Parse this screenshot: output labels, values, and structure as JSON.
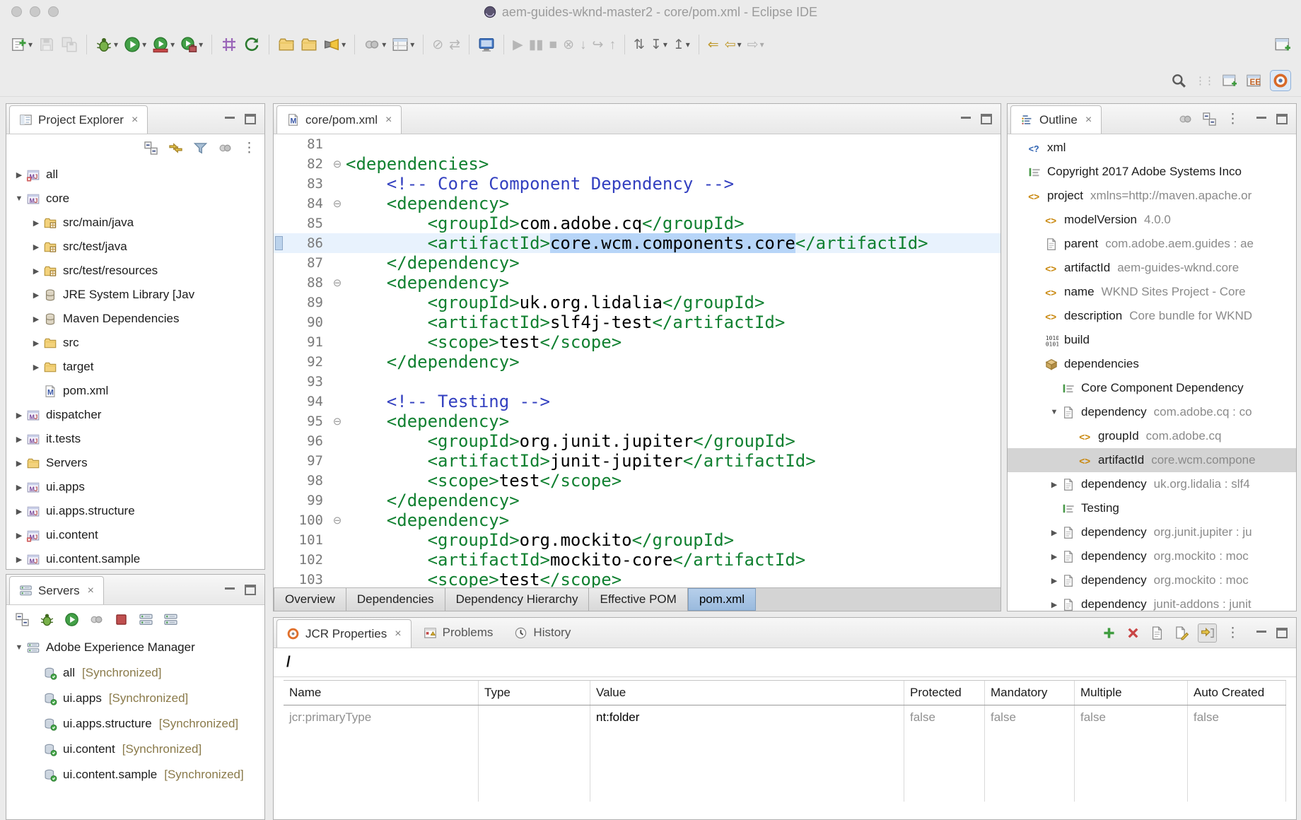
{
  "titlebar": {
    "title": "aem-guides-wknd-master2 - core/pom.xml - Eclipse IDE"
  },
  "colors": {
    "xml_tag": "#108030",
    "xml_comment": "#3340c0",
    "selection": "#b7d5f8",
    "current_line": "#e8f2fd",
    "sync_status": "#8a7a4a",
    "active_tab_blue": "#9abadd"
  },
  "main_toolbar": {
    "items": [
      {
        "name": "new-wizard",
        "icon": "new",
        "dropdown": true
      },
      {
        "name": "save",
        "icon": "floppy",
        "disabled": true
      },
      {
        "name": "save-all",
        "icon": "floppy2",
        "disabled": true
      },
      {
        "sep": true
      },
      {
        "name": "debug",
        "icon": "bug",
        "dropdown": true
      },
      {
        "name": "run",
        "icon": "runc",
        "dropdown": true
      },
      {
        "name": "coverage",
        "icon": "covc",
        "dropdown": true
      },
      {
        "name": "run-external-tools",
        "icon": "extc",
        "dropdown": true
      },
      {
        "sep": true
      },
      {
        "name": "new-java-project",
        "icon": "grid"
      },
      {
        "name": "generate",
        "icon": "gref"
      },
      {
        "sep": true
      },
      {
        "name": "open-type",
        "icon": "folder"
      },
      {
        "name": "open-resource",
        "icon": "folder"
      },
      {
        "name": "search",
        "icon": "torch",
        "dropdown": true
      },
      {
        "sep": true
      },
      {
        "name": "annotations",
        "icon": "graydot",
        "dropdown": true
      },
      {
        "name": "new-editor-window",
        "icon": "persp",
        "dropdown": true
      },
      {
        "sep": true
      },
      {
        "name": "skip-all-breakpoints",
        "glyph": "⊘",
        "disabled": true
      },
      {
        "name": "link-with-editor",
        "glyph": "⇄",
        "disabled": true
      },
      {
        "sep": true
      },
      {
        "name": "show-console",
        "icon": "monitor"
      },
      {
        "sep": true
      },
      {
        "name": "resume",
        "glyph": "▶",
        "disabled": true
      },
      {
        "name": "suspend",
        "glyph": "▮▮",
        "disabled": true
      },
      {
        "name": "terminate",
        "glyph": "■",
        "disabled": true
      },
      {
        "name": "disconnect",
        "glyph": "⊗",
        "disabled": true
      },
      {
        "name": "step-into",
        "glyph": "↓",
        "disabled": true
      },
      {
        "name": "step-over",
        "glyph": "↪",
        "disabled": true
      },
      {
        "name": "step-return",
        "glyph": "↑",
        "disabled": true
      },
      {
        "sep": true
      },
      {
        "name": "synchronize",
        "glyph": "⇅"
      },
      {
        "name": "fetch",
        "glyph": "↧",
        "dropdown": true
      },
      {
        "name": "push",
        "glyph": "↥",
        "dropdown": true
      },
      {
        "sep": true
      },
      {
        "name": "last-edit-location",
        "glyph": "⇐",
        "accent": true
      },
      {
        "name": "back",
        "glyph": "⇦",
        "dropdown": true,
        "accent": true
      },
      {
        "name": "forward",
        "glyph": "⇨",
        "dropdown": true,
        "disabled": true
      },
      {
        "name": "open-perspective-window",
        "icon": "winnew",
        "mlauto": true
      }
    ]
  },
  "perspective_bar": {
    "items": [
      {
        "name": "search",
        "icon": "mag"
      },
      {
        "handle": true
      },
      {
        "name": "open-perspective",
        "icon": "winnew"
      },
      {
        "name": "perspective-java-ee",
        "icon": "jee"
      },
      {
        "name": "perspective-current",
        "icon": "aemp",
        "active": true
      }
    ]
  },
  "project_explorer": {
    "title": "Project Explorer",
    "toolbar": [
      {
        "name": "collapse-all",
        "icon": "collapse"
      },
      {
        "name": "link-with-editor",
        "icon": "linkarrows"
      },
      {
        "name": "filters",
        "icon": "funnel"
      },
      {
        "name": "focus",
        "icon": "graydot"
      },
      {
        "name": "view-menu",
        "glyph": "⋮"
      }
    ],
    "items": [
      {
        "label": "all",
        "icon": "projecterr",
        "depth": 0,
        "exp": "c"
      },
      {
        "label": "core",
        "icon": "project",
        "depth": 0,
        "exp": "e"
      },
      {
        "label": "src/main/java",
        "icon": "srcfolder",
        "depth": 1,
        "exp": "c"
      },
      {
        "label": "src/test/java",
        "icon": "srcfolder",
        "depth": 1,
        "exp": "c"
      },
      {
        "label": "src/test/resources",
        "icon": "srcfolder",
        "depth": 1,
        "exp": "c"
      },
      {
        "label": "JRE System Library [Jav",
        "icon": "library",
        "depth": 1,
        "exp": "c"
      },
      {
        "label": "Maven Dependencies",
        "icon": "library",
        "depth": 1,
        "exp": "c"
      },
      {
        "label": "src",
        "icon": "folder",
        "depth": 1,
        "exp": "c"
      },
      {
        "label": "target",
        "icon": "folder",
        "depth": 1,
        "exp": "c"
      },
      {
        "label": "pom.xml",
        "icon": "mfile",
        "depth": 1
      },
      {
        "label": "dispatcher",
        "icon": "project",
        "depth": 0,
        "exp": "c"
      },
      {
        "label": "it.tests",
        "icon": "project",
        "depth": 0,
        "exp": "c"
      },
      {
        "label": "Servers",
        "icon": "folder",
        "depth": 0,
        "exp": "c"
      },
      {
        "label": "ui.apps",
        "icon": "project",
        "depth": 0,
        "exp": "c"
      },
      {
        "label": "ui.apps.structure",
        "icon": "project",
        "depth": 0,
        "exp": "c"
      },
      {
        "label": "ui.content",
        "icon": "projecterr",
        "depth": 0,
        "exp": "c"
      },
      {
        "label": "ui.content.sample",
        "icon": "project",
        "depth": 0,
        "exp": "c"
      }
    ]
  },
  "servers": {
    "title": "Servers",
    "toolbar": [
      {
        "name": "collapse-all",
        "icon": "collapse"
      },
      {
        "name": "debug-server",
        "icon": "bug"
      },
      {
        "name": "start-server",
        "icon": "runc"
      },
      {
        "name": "profile-server",
        "icon": "graydot"
      },
      {
        "name": "stop-server",
        "icon": "stopred"
      },
      {
        "name": "publish-to-server",
        "icon": "server"
      },
      {
        "name": "clean-server",
        "icon": "server"
      }
    ],
    "items": [
      {
        "label": "Adobe Experience Manager",
        "icon": "server",
        "depth": 0,
        "exp": "e"
      },
      {
        "label": "all",
        "status": "[Synchronized]",
        "icon": "bundle",
        "depth": 1
      },
      {
        "label": "ui.apps",
        "status": "[Synchronized]",
        "icon": "bundle",
        "depth": 1
      },
      {
        "label": "ui.apps.structure",
        "status": "[Synchronized]",
        "icon": "bundle",
        "depth": 1
      },
      {
        "label": "ui.content",
        "status": "[Synchronized]",
        "icon": "bundle",
        "depth": 1
      },
      {
        "label": "ui.content.sample",
        "status": "[Synchronized]",
        "icon": "bundle",
        "depth": 1
      }
    ]
  },
  "editor": {
    "tab_label": "core/pom.xml",
    "bottom_tabs": [
      {
        "label": "Overview"
      },
      {
        "label": "Dependencies"
      },
      {
        "label": "Dependency Hierarchy"
      },
      {
        "label": "Effective POM"
      },
      {
        "label": "pom.xml",
        "active": true
      }
    ],
    "lines": [
      {
        "n": 81,
        "tokens": []
      },
      {
        "n": 82,
        "fold": true,
        "tokens": [
          [
            "<dependencies>",
            "g"
          ]
        ]
      },
      {
        "n": 83,
        "tokens": [
          [
            "    <!-- Core Component Dependency -->",
            "c"
          ]
        ]
      },
      {
        "n": 84,
        "fold": true,
        "tokens": [
          [
            "    <dependency>",
            "g"
          ]
        ]
      },
      {
        "n": 85,
        "tokens": [
          [
            "        <groupId>",
            "g"
          ],
          [
            "com.adobe.cq",
            "t"
          ],
          [
            "</groupId>",
            "g"
          ]
        ]
      },
      {
        "n": 86,
        "cur": true,
        "marker": true,
        "tokens": [
          [
            "        <artifactId>",
            "g"
          ],
          [
            "core.wcm.components.core",
            "s"
          ],
          [
            "</artifactId>",
            "g"
          ]
        ]
      },
      {
        "n": 87,
        "tokens": [
          [
            "    </dependency>",
            "g"
          ]
        ]
      },
      {
        "n": 88,
        "fold": true,
        "tokens": [
          [
            "    <dependency>",
            "g"
          ]
        ]
      },
      {
        "n": 89,
        "tokens": [
          [
            "        <groupId>",
            "g"
          ],
          [
            "uk.org.lidalia",
            "t"
          ],
          [
            "</groupId>",
            "g"
          ]
        ]
      },
      {
        "n": 90,
        "tokens": [
          [
            "        <artifactId>",
            "g"
          ],
          [
            "slf4j-test",
            "t"
          ],
          [
            "</artifactId>",
            "g"
          ]
        ]
      },
      {
        "n": 91,
        "tokens": [
          [
            "        <scope>",
            "g"
          ],
          [
            "test",
            "t"
          ],
          [
            "</scope>",
            "g"
          ]
        ]
      },
      {
        "n": 92,
        "tokens": [
          [
            "    </dependency>",
            "g"
          ]
        ]
      },
      {
        "n": 93,
        "tokens": []
      },
      {
        "n": 94,
        "tokens": [
          [
            "    <!-- Testing -->",
            "c"
          ]
        ]
      },
      {
        "n": 95,
        "fold": true,
        "tokens": [
          [
            "    <dependency>",
            "g"
          ]
        ]
      },
      {
        "n": 96,
        "tokens": [
          [
            "        <groupId>",
            "g"
          ],
          [
            "org.junit.jupiter",
            "t"
          ],
          [
            "</groupId>",
            "g"
          ]
        ]
      },
      {
        "n": 97,
        "tokens": [
          [
            "        <artifactId>",
            "g"
          ],
          [
            "junit-jupiter",
            "t"
          ],
          [
            "</artifactId>",
            "g"
          ]
        ]
      },
      {
        "n": 98,
        "tokens": [
          [
            "        <scope>",
            "g"
          ],
          [
            "test",
            "t"
          ],
          [
            "</scope>",
            "g"
          ]
        ]
      },
      {
        "n": 99,
        "tokens": [
          [
            "    </dependency>",
            "g"
          ]
        ]
      },
      {
        "n": 100,
        "fold": true,
        "tokens": [
          [
            "    <dependency>",
            "g"
          ]
        ]
      },
      {
        "n": 101,
        "tokens": [
          [
            "        <groupId>",
            "g"
          ],
          [
            "org.mockito",
            "t"
          ],
          [
            "</groupId>",
            "g"
          ]
        ]
      },
      {
        "n": 102,
        "tokens": [
          [
            "        <artifactId>",
            "g"
          ],
          [
            "mockito-core",
            "t"
          ],
          [
            "</artifactId>",
            "g"
          ]
        ]
      },
      {
        "n": 103,
        "tokens": [
          [
            "        <scope>",
            "g"
          ],
          [
            "test",
            "t"
          ],
          [
            "</scope>",
            "g"
          ]
        ]
      }
    ]
  },
  "outline": {
    "title": "Outline",
    "toolbar": [
      {
        "name": "focus",
        "icon": "graydot"
      },
      {
        "name": "collapse-all",
        "icon": "collapse"
      },
      {
        "name": "view-menu",
        "glyph": "⋮"
      }
    ],
    "items": [
      {
        "label": "xml",
        "icon": "xmldecl",
        "depth": 0
      },
      {
        "label": "Copyright 2017 Adobe Systems Inco",
        "icon": "xmlcom",
        "depth": 0
      },
      {
        "label": "project",
        "detail": "xmlns=http://maven.apache.or",
        "icon": "xmlel",
        "depth": 0
      },
      {
        "label": "modelVersion",
        "detail": "4.0.0",
        "icon": "xmlel",
        "depth": 1
      },
      {
        "label": "parent",
        "detail": "com.adobe.aem.guides : ae",
        "icon": "page",
        "depth": 1
      },
      {
        "label": "artifactId",
        "detail": "aem-guides-wknd.core",
        "icon": "xmlel",
        "depth": 1
      },
      {
        "label": "name",
        "detail": "WKND Sites Project - Core",
        "icon": "xmlel",
        "depth": 1
      },
      {
        "label": "description",
        "detail": "Core bundle for WKND",
        "icon": "xmlel",
        "depth": 1
      },
      {
        "label": "build",
        "icon": "build",
        "depth": 1
      },
      {
        "label": "dependencies",
        "icon": "deps",
        "depth": 1
      },
      {
        "label": "Core Component Dependency",
        "icon": "xmlcom",
        "depth": 2
      },
      {
        "label": "dependency",
        "detail": "com.adobe.cq : co",
        "icon": "page",
        "depth": 2,
        "exp": "e"
      },
      {
        "label": "groupId",
        "detail": "com.adobe.cq",
        "icon": "xmlel",
        "depth": 3
      },
      {
        "label": "artifactId",
        "detail": "core.wcm.compone",
        "icon": "xmlel",
        "depth": 3,
        "selected": true
      },
      {
        "label": "dependency",
        "detail": "uk.org.lidalia : slf4",
        "icon": "page",
        "depth": 2,
        "exp": "c"
      },
      {
        "label": "Testing",
        "icon": "xmlcom",
        "depth": 2
      },
      {
        "label": "dependency",
        "detail": "org.junit.jupiter : ju",
        "icon": "page",
        "depth": 2,
        "exp": "c"
      },
      {
        "label": "dependency",
        "detail": "org.mockito : moc",
        "icon": "page",
        "depth": 2,
        "exp": "c"
      },
      {
        "label": "dependency",
        "detail": "org.mockito : moc",
        "icon": "page",
        "depth": 2,
        "exp": "c"
      },
      {
        "label": "dependency",
        "detail": "junit-addons : junit",
        "icon": "page",
        "depth": 2,
        "exp": "c"
      }
    ]
  },
  "bottom_panel": {
    "tabs": [
      {
        "label": "JCR Properties",
        "active": true
      },
      {
        "label": "Problems"
      },
      {
        "label": "History"
      }
    ],
    "toolbar": [
      {
        "name": "add-property",
        "icon": "plus"
      },
      {
        "name": "remove-property",
        "icon": "cross"
      },
      {
        "name": "show-properties",
        "icon": "page"
      },
      {
        "name": "export-properties",
        "icon": "pageedit"
      },
      {
        "name": "link-with-editor",
        "icon": "linky",
        "pressed": true
      },
      {
        "name": "view-menu",
        "glyph": "⋮"
      }
    ],
    "path": "/",
    "table": {
      "columns": [
        "Name",
        "Type",
        "Value",
        "Protected",
        "Mandatory",
        "Multiple",
        "Auto Created"
      ],
      "rows": [
        {
          "name": "jcr:primaryType",
          "type": "",
          "value": "nt:folder",
          "protected": "false",
          "mandatory": "false",
          "multiple": "false",
          "auto_created": "false"
        }
      ]
    }
  }
}
